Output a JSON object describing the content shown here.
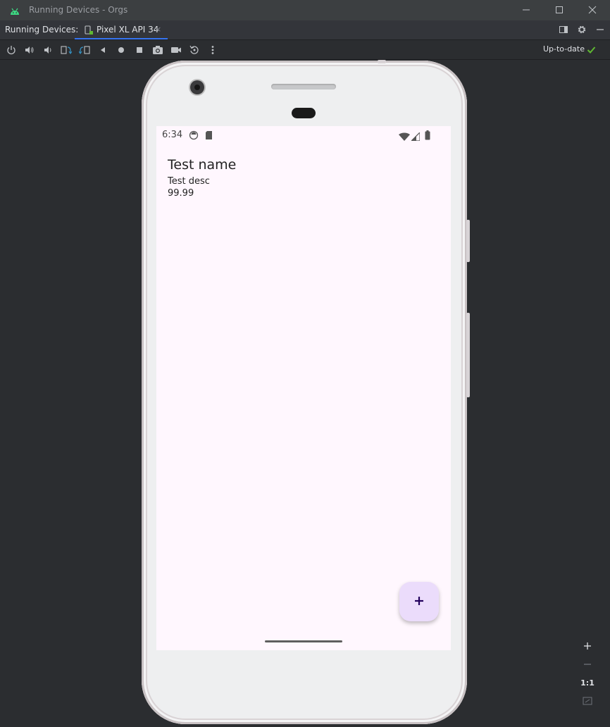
{
  "window": {
    "title": "Running Devices - Orgs",
    "icon": "android-icon",
    "controls": [
      "minimize-icon",
      "maximize-icon",
      "close-icon"
    ]
  },
  "tabbar": {
    "label": "Running Devices:",
    "tab": {
      "title": "Pixel XL API 34",
      "icon": "phone-icon",
      "close": "×"
    },
    "tools": [
      "layout-icon",
      "gear-icon",
      "minimize-panel-icon"
    ]
  },
  "toolbar": {
    "buttons": [
      "power-icon",
      "volume-up-icon",
      "volume-down-icon",
      "rotate-left-icon",
      "rotate-right-icon",
      "back-icon",
      "home-icon",
      "overview-icon",
      "screenshot-icon",
      "screen-record-icon",
      "reset-icon",
      "more-icon"
    ],
    "status": "Up-to-date",
    "status_color": "#5fb832"
  },
  "device": {
    "status_bar": {
      "time": "6:34",
      "icons": [
        "debug-icon",
        "sd-card-icon",
        "wifi-icon",
        "signal-icon",
        "battery-icon"
      ]
    },
    "item": {
      "name": "Test name",
      "description": "Test desc",
      "price": "99.99"
    },
    "fab": {
      "label": "+",
      "color": "#ebdcfb"
    },
    "background": "#fff7fe"
  },
  "zoom_controls": {
    "zoom_in": "+",
    "zoom_out": "−",
    "actual_size": "1:1",
    "fit": "fit-screen-icon"
  }
}
